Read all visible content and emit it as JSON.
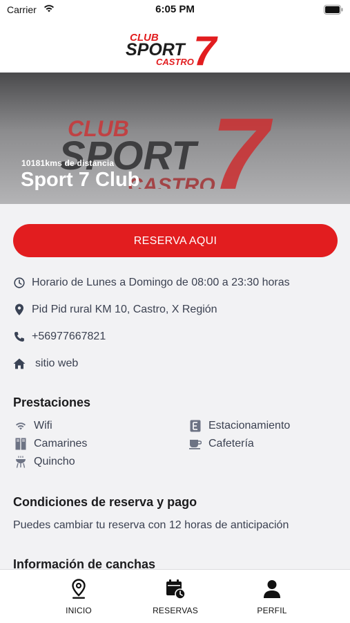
{
  "status_bar": {
    "carrier": "Carrier",
    "time": "6:05 PM"
  },
  "header": {
    "logo": {
      "line1": "CLUB",
      "line2": "SPORT",
      "line3": "CASTRO",
      "number": "7"
    }
  },
  "hero": {
    "logo": {
      "line1": "CLUB",
      "line2": "SPORT",
      "line3": "CASTRO",
      "number": "7"
    },
    "distance": "10181kms de distancia",
    "club_name": "Sport 7 Club"
  },
  "reserve_button": {
    "label": "RESERVA AQUI"
  },
  "info": {
    "schedule": "Horario de Lunes a Domingo de 08:00 a 23:30 horas",
    "address": "Pid Pid rural KM 10, Castro, X Región",
    "phone": "+56977667821",
    "website": "sitio web"
  },
  "amenities": {
    "title": "Prestaciones",
    "items": [
      "Wifi",
      "Estacionamiento",
      "Camarines",
      "Cafetería",
      "Quincho"
    ]
  },
  "conditions": {
    "title": "Condiciones de reserva y pago",
    "text": "Puedes cambiar tu reserva con 12 horas de anticipación"
  },
  "courts": {
    "title": "Información de canchas"
  },
  "tabbar": {
    "items": [
      {
        "label": "INICIO",
        "icon": "map-pin-icon"
      },
      {
        "label": "RESERVAS",
        "icon": "calendar-clock-icon"
      },
      {
        "label": "PERFIL",
        "icon": "user-icon"
      }
    ]
  },
  "colors": {
    "accent": "#e21d1f",
    "text_secondary": "#3b4151",
    "icon": "#3a4355"
  }
}
